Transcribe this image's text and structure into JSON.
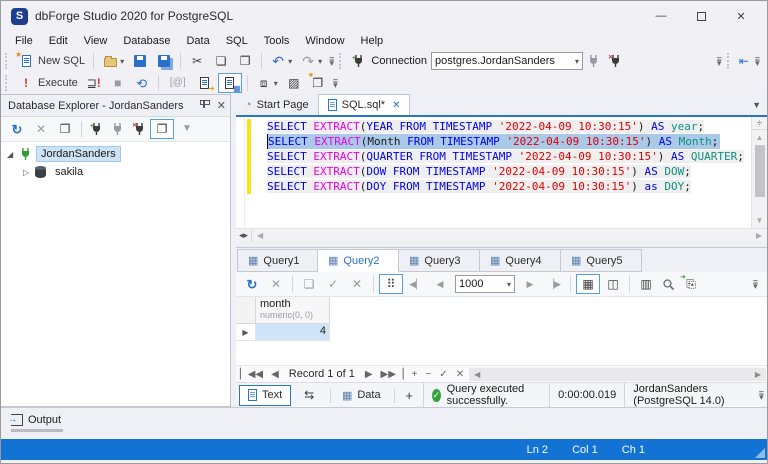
{
  "titlebar": {
    "title": "dbForge Studio 2020 for PostgreSQL"
  },
  "menubar": {
    "items": [
      "File",
      "Edit",
      "View",
      "Database",
      "Data",
      "SQL",
      "Tools",
      "Window",
      "Help"
    ]
  },
  "toolbar_standard": {
    "new_sql": "New SQL",
    "connection_label": "Connection",
    "connection_value": "postgres.JordanSanders"
  },
  "toolbar_query": {
    "execute": "Execute",
    "params": "[@]"
  },
  "explorer": {
    "title": "Database Explorer - JordanSanders",
    "nodes": [
      {
        "label": "JordanSanders"
      },
      {
        "label": "sakila"
      }
    ]
  },
  "doc_tabs": {
    "start_page": "Start Page",
    "sql_tab": "SQL.sql*"
  },
  "editor": {
    "selected_line": 1,
    "lines": [
      {
        "tokens": [
          {
            "t": "SELECT ",
            "c": "kw"
          },
          {
            "t": "EXTRACT",
            "c": "fn"
          },
          {
            "t": "(",
            "c": "pl"
          },
          {
            "t": "YEAR FROM TIMESTAMP ",
            "c": "kw"
          },
          {
            "t": "'2022-04-09 10:30:15'",
            "c": "str"
          },
          {
            "t": ") ",
            "c": "pl"
          },
          {
            "t": "AS ",
            "c": "kw"
          },
          {
            "t": "year",
            "c": "al"
          },
          {
            "t": ";",
            "c": "pl"
          }
        ]
      },
      {
        "tokens": [
          {
            "t": "SELECT ",
            "c": "kw"
          },
          {
            "t": "EXTRACT",
            "c": "fn"
          },
          {
            "t": "(",
            "c": "pl"
          },
          {
            "t": "Month",
            "c": "id"
          },
          {
            "t": " ",
            "c": "pl"
          },
          {
            "t": "FROM TIMESTAMP ",
            "c": "kw"
          },
          {
            "t": "'2022-04-09 10:30:15'",
            "c": "str"
          },
          {
            "t": ") ",
            "c": "pl"
          },
          {
            "t": "AS ",
            "c": "kw"
          },
          {
            "t": "Month",
            "c": "al"
          },
          {
            "t": ";",
            "c": "pl"
          }
        ]
      },
      {
        "tokens": [
          {
            "t": "SELECT ",
            "c": "kw"
          },
          {
            "t": "EXTRACT",
            "c": "fn"
          },
          {
            "t": "(",
            "c": "pl"
          },
          {
            "t": "QUARTER FROM TIMESTAMP ",
            "c": "kw"
          },
          {
            "t": "'2022-04-09 10:30:15'",
            "c": "str"
          },
          {
            "t": ") ",
            "c": "pl"
          },
          {
            "t": "AS ",
            "c": "kw"
          },
          {
            "t": "QUARTER",
            "c": "al"
          },
          {
            "t": ";",
            "c": "pl"
          }
        ]
      },
      {
        "tokens": [
          {
            "t": "SELECT ",
            "c": "kw"
          },
          {
            "t": "EXTRACT",
            "c": "fn"
          },
          {
            "t": "(",
            "c": "pl"
          },
          {
            "t": "DOW FROM TIMESTAMP ",
            "c": "kw"
          },
          {
            "t": "'2022-04-09 10:30:15'",
            "c": "str"
          },
          {
            "t": ") ",
            "c": "pl"
          },
          {
            "t": "AS ",
            "c": "kw"
          },
          {
            "t": "DOW",
            "c": "al"
          },
          {
            "t": ";",
            "c": "pl"
          }
        ]
      },
      {
        "tokens": [
          {
            "t": "SELECT ",
            "c": "kw"
          },
          {
            "t": "EXTRACT",
            "c": "fn"
          },
          {
            "t": "(",
            "c": "pl"
          },
          {
            "t": "DOY FROM TIMESTAMP ",
            "c": "kw"
          },
          {
            "t": "'2022-04-09 10:30:15'",
            "c": "str"
          },
          {
            "t": ") ",
            "c": "pl"
          },
          {
            "t": "as ",
            "c": "kw"
          },
          {
            "t": "DOY",
            "c": "al"
          },
          {
            "t": ";",
            "c": "pl"
          }
        ]
      }
    ]
  },
  "results": {
    "query_tabs": [
      "Query1",
      "Query2",
      "Query3",
      "Query4",
      "Query5"
    ],
    "active_tab": "Query2",
    "page_size": "1000",
    "grid": {
      "column_name": "month",
      "column_type": "numeric(0, 0)",
      "row_value": "4"
    },
    "record_status": "Record 1 of 1",
    "view_tabs": {
      "text": "Text",
      "data": "Data",
      "add": "+"
    },
    "status": {
      "message": "Query executed successfully.",
      "duration": "0:00:00.019",
      "connection": "JordanSanders (PostgreSQL 14.0)"
    }
  },
  "output": {
    "label": "Output"
  },
  "statusbar": {
    "line": "Ln 2",
    "col": "Col 1",
    "ch": "Ch 1"
  },
  "colors": {
    "accent": "#1273d4",
    "keyword": "#0000e8",
    "function": "#e800e8",
    "string": "#e00000",
    "alias": "#0d8f80",
    "change_bar": "#f5e511",
    "success": "#35a33c"
  }
}
